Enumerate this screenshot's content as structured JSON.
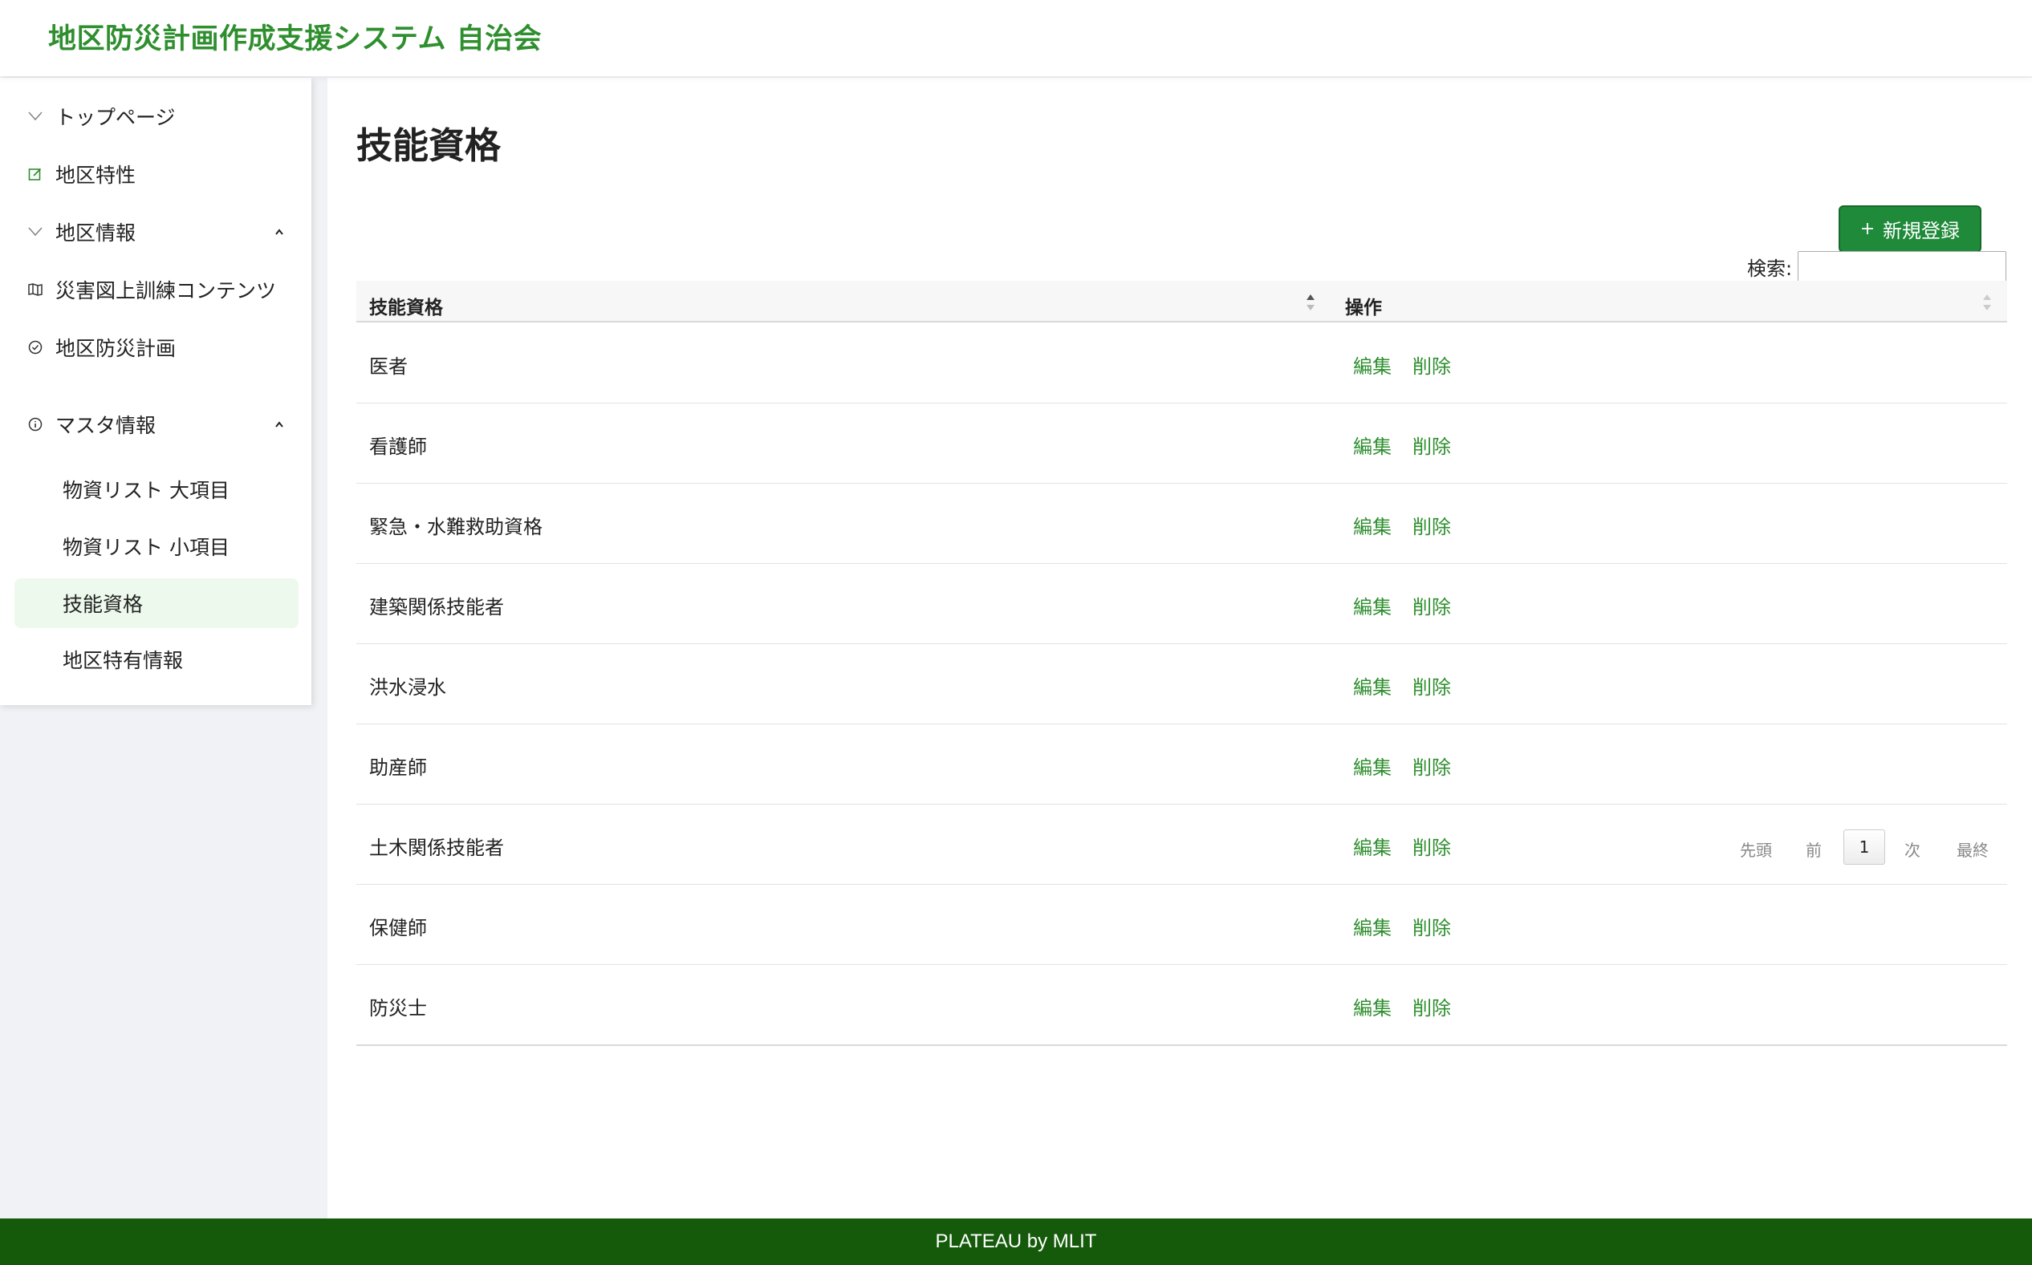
{
  "app": {
    "title": "地区防災計画作成支援システム 自治会"
  },
  "sidebar": {
    "items": [
      {
        "label": "トップページ",
        "icon": "chevron-down-icon"
      },
      {
        "label": "地区特性",
        "icon": "edit-icon"
      },
      {
        "label": "地区情報",
        "icon": "chevron-down-icon",
        "caret": "caret-up-icon"
      },
      {
        "label": "災害図上訓練コンテンツ",
        "icon": "map-icon"
      },
      {
        "label": "地区防災計画",
        "icon": "check-circle-icon"
      },
      {
        "label": "マスタ情報",
        "icon": "info-circle-icon",
        "caret": "caret-up-icon"
      }
    ],
    "sub_items": [
      {
        "label": "物資リスト 大項目"
      },
      {
        "label": "物資リスト 小項目"
      },
      {
        "label": "技能資格",
        "active": true
      },
      {
        "label": "地区特有情報"
      }
    ]
  },
  "main": {
    "title": "技能資格",
    "new_button": {
      "icon": "plus-icon",
      "label": "新規登録"
    },
    "search": {
      "label": "検索:",
      "value": "",
      "placeholder": ""
    },
    "table": {
      "headers": [
        "技能資格",
        "操作"
      ],
      "edit_label": "編集",
      "delete_label": "削除",
      "rows": [
        "医者",
        "看護師",
        "緊急・水難救助資格",
        "建築関係技能者",
        "洪水浸水",
        "助産師",
        "土木関係技能者",
        "保健師",
        "防災士"
      ]
    },
    "pagination": {
      "first": "先頭",
      "prev": "前",
      "current": "1",
      "next": "次",
      "last": "最終"
    }
  },
  "footer": {
    "text": "PLATEAU by MLIT"
  },
  "colors": {
    "brand_green": "#2f8f2f",
    "button_green": "#1f8a3a",
    "footer_green": "#155a0b",
    "active_bg": "#edf9ed"
  }
}
